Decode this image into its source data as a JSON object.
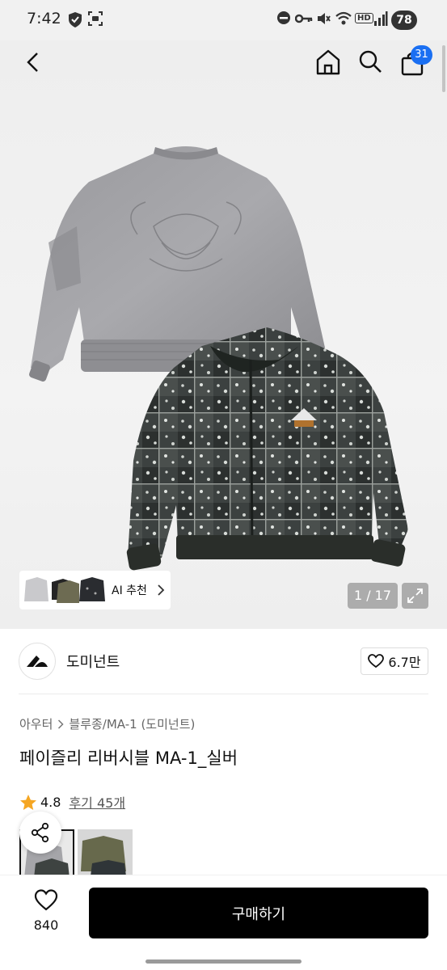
{
  "status_bar": {
    "time": "7:42",
    "battery": "78",
    "hd": "HD"
  },
  "nav": {
    "cart_badge": "31"
  },
  "gallery": {
    "ai_label": "AI 추천",
    "counter": "1 / 17"
  },
  "brand": {
    "name": "도미넌트",
    "likes": "6.7만"
  },
  "product": {
    "breadcrumb": [
      "아우터",
      "블루종/MA-1 (도미넌트)"
    ],
    "title": "페이즐리 리버시블 MA-1_실버",
    "rating": "4.8",
    "reviews": "후기 45개"
  },
  "bottom": {
    "wish_count": "840",
    "buy_label": "구매하기"
  },
  "colors": {
    "accent": "#1a6ff2",
    "star": "#f5a623",
    "buy_button": "#000000"
  }
}
